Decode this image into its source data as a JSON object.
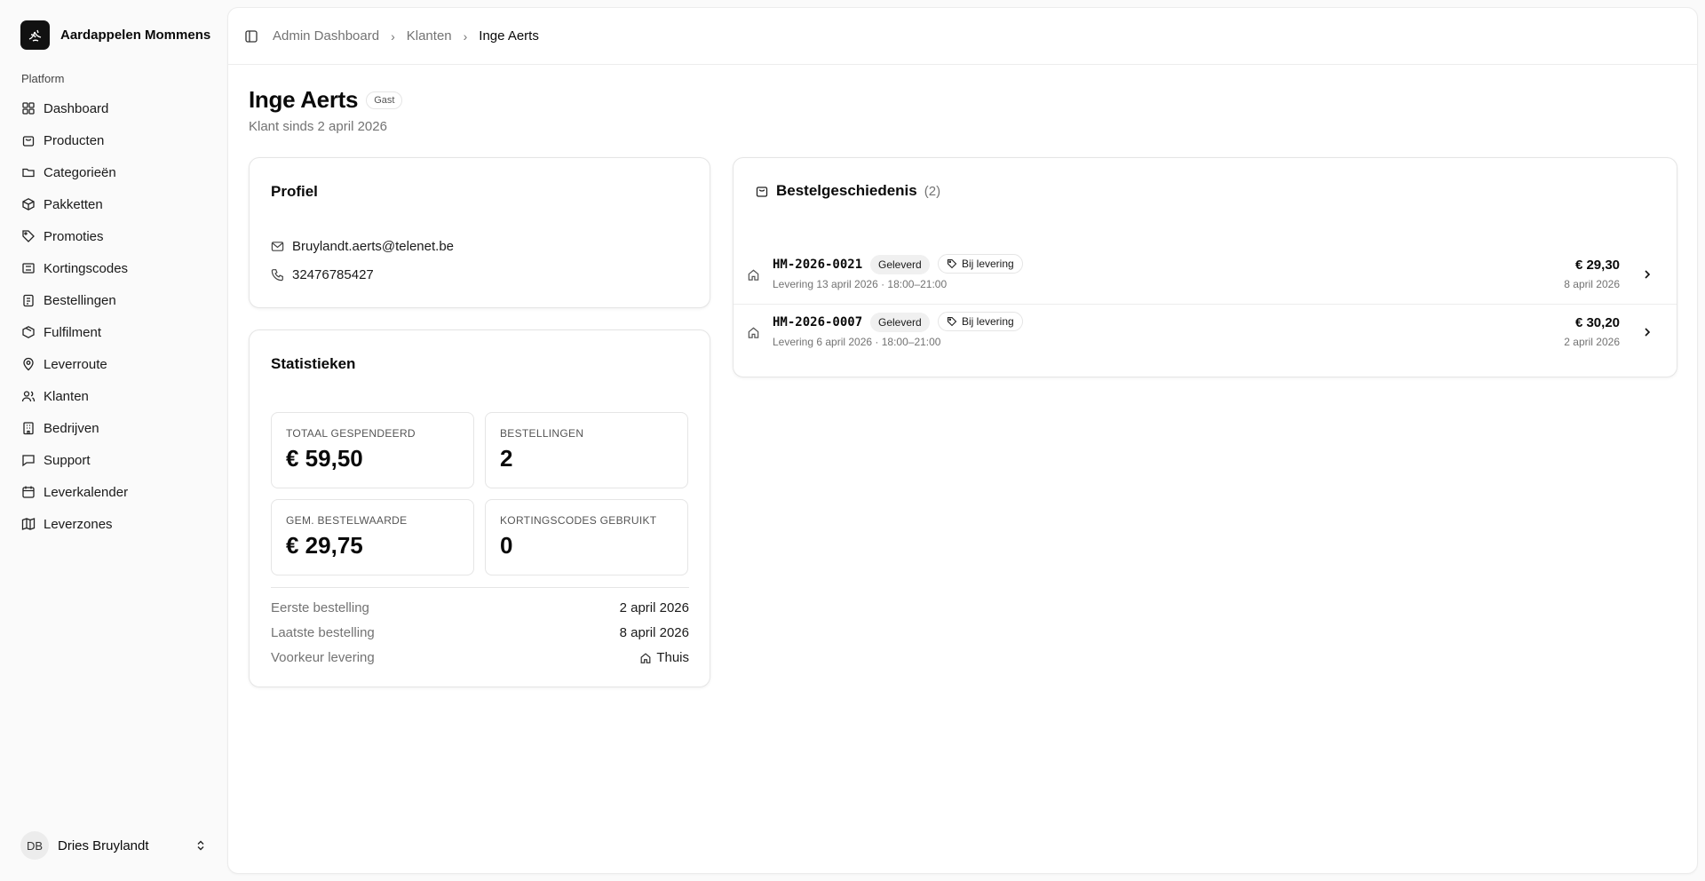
{
  "brand": {
    "name": "Aardappelen Mommens",
    "logo_icon": "potato-leaf-icon"
  },
  "sidebar": {
    "group_label": "Platform",
    "items": [
      {
        "label": "Dashboard",
        "icon": "grid-icon"
      },
      {
        "label": "Producten",
        "icon": "shopping-bag-icon"
      },
      {
        "label": "Categorieën",
        "icon": "folder-icon"
      },
      {
        "label": "Pakketten",
        "icon": "package-icon"
      },
      {
        "label": "Promoties",
        "icon": "tag-icon"
      },
      {
        "label": "Kortingscodes",
        "icon": "ticket-icon"
      },
      {
        "label": "Bestellingen",
        "icon": "clipboard-icon"
      },
      {
        "label": "Fulfilment",
        "icon": "box-icon"
      },
      {
        "label": "Leverroute",
        "icon": "map-pin-icon"
      },
      {
        "label": "Klanten",
        "icon": "users-icon"
      },
      {
        "label": "Bedrijven",
        "icon": "building-icon"
      },
      {
        "label": "Support",
        "icon": "message-icon"
      },
      {
        "label": "Leverkalender",
        "icon": "calendar-icon"
      },
      {
        "label": "Leverzones",
        "icon": "map-icon"
      }
    ]
  },
  "user": {
    "initials": "DB",
    "name": "Dries Bruylandt"
  },
  "breadcrumb": {
    "items": [
      "Admin Dashboard",
      "Klanten",
      "Inge Aerts"
    ]
  },
  "customer": {
    "name": "Inge Aerts",
    "badge": "Gast",
    "since": "Klant sinds 2 april 2026"
  },
  "profile": {
    "title": "Profiel",
    "email": "Bruylandt.aerts@telenet.be",
    "phone": "32476785427"
  },
  "stats": {
    "title": "Statistieken",
    "tiles": [
      {
        "label": "TOTAAL GESPENDEERD",
        "value": "€ 59,50"
      },
      {
        "label": "BESTELLINGEN",
        "value": "2"
      },
      {
        "label": "GEM. BESTELWAARDE",
        "value": "€ 29,75"
      },
      {
        "label": "KORTINGSCODES GEBRUIKT",
        "value": "0"
      }
    ],
    "rows": [
      {
        "label": "Eerste bestelling",
        "value": "2 april 2026"
      },
      {
        "label": "Laatste bestelling",
        "value": "8 april 2026"
      },
      {
        "label": "Voorkeur levering",
        "value": "Thuis"
      }
    ]
  },
  "orders": {
    "title": "Bestelgeschiedenis",
    "count": "(2)",
    "items": [
      {
        "number": "HM-2026-0021",
        "status": "Geleverd",
        "method": "Bij levering",
        "delivery": "Levering 13 april 2026 · 18:00–21:00",
        "total": "€ 29,30",
        "date": "8 april 2026"
      },
      {
        "number": "HM-2026-0007",
        "status": "Geleverd",
        "method": "Bij levering",
        "delivery": "Levering 6 april 2026 · 18:00–21:00",
        "total": "€ 30,20",
        "date": "2 april 2026"
      }
    ]
  }
}
